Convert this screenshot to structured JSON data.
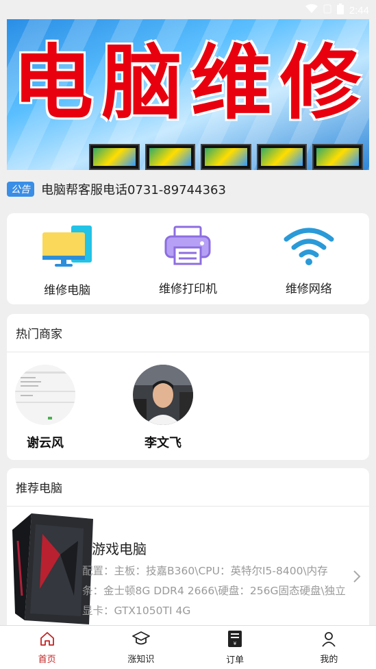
{
  "status_bar": {
    "time": "2:44",
    "icons": [
      "wifi-icon",
      "sim-icon",
      "battery-icon"
    ]
  },
  "banner": {
    "chars": [
      "电",
      "脑",
      "维",
      "修"
    ]
  },
  "notice": {
    "tag": "公告",
    "text": "电脑帮客服电话0731-89744363"
  },
  "services": [
    {
      "label": "维修电脑",
      "icon": "monitor-icon"
    },
    {
      "label": "维修打印机",
      "icon": "printer-icon"
    },
    {
      "label": "维修网络",
      "icon": "wifi-icon"
    }
  ],
  "merchants": {
    "title": "热门商家",
    "items": [
      {
        "name": "谢云风"
      },
      {
        "name": "李文飞"
      }
    ]
  },
  "recommend": {
    "title": "推荐电脑",
    "product": {
      "name": "游戏电脑",
      "desc": "配置：主板：技嘉B360\\CPU：英特尔I5-8400\\内存条：金士顿8G DDR4 2666\\硬盘：256G固态硬盘\\独立显卡：GTX1050TI 4G"
    }
  },
  "tabbar": [
    {
      "label": "首页",
      "icon": "home-icon",
      "active": true
    },
    {
      "label": "涨知识",
      "icon": "graduation-cap-icon",
      "active": false
    },
    {
      "label": "订单",
      "icon": "order-icon",
      "active": false
    },
    {
      "label": "我的",
      "icon": "user-icon",
      "active": false
    }
  ],
  "colors": {
    "accent": "#c32121",
    "notice_tag": "#3a8ee6",
    "banner_text": "#e8000e"
  }
}
